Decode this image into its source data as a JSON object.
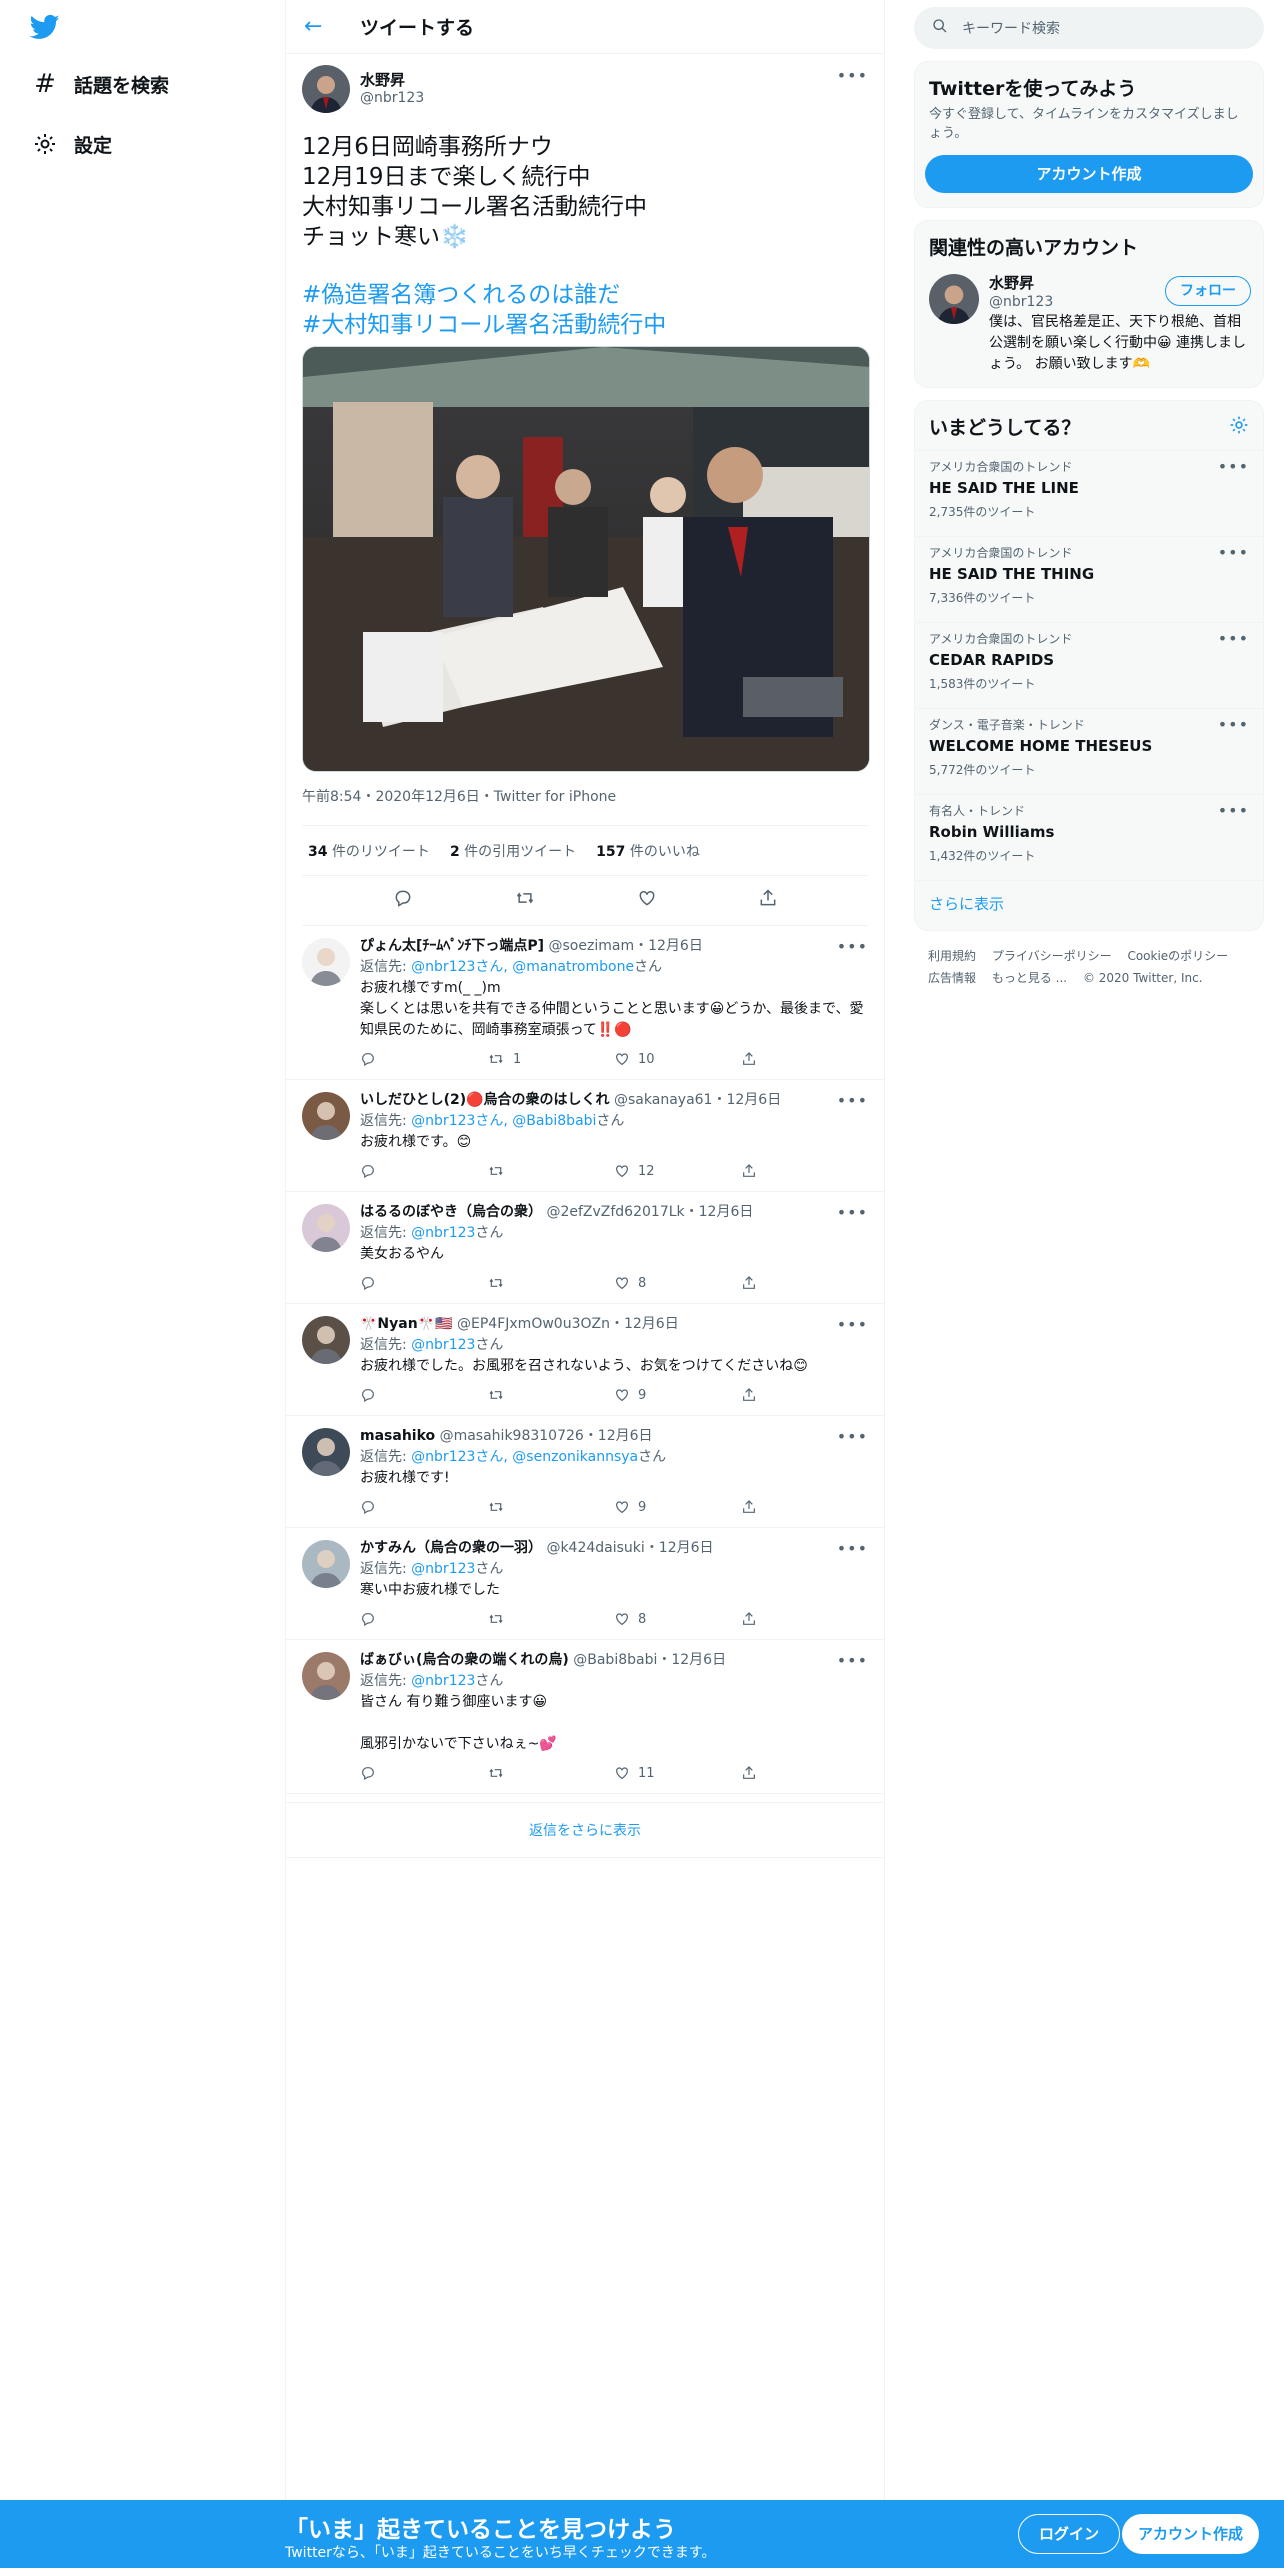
{
  "nav": {
    "explore_label": "話題を検索",
    "settings_label": "設定"
  },
  "header": {
    "title": "ツイートする"
  },
  "tweet": {
    "author_name": "水野昇",
    "author_handle": "@nbr123",
    "body": "12月6日岡崎事務所ナウ\n12月19日まで楽しく続行中\n大村知事リコール署名活動続行中\nチョット寒い❄️",
    "hashtags": [
      "#偽造署名簿つくれるのは誰だ",
      "#大村知事リコール署名活動続行中"
    ],
    "meta": "午前8:54・2020年12月6日・Twitter for iPhone",
    "retweets": "34",
    "retweets_label": "件のリツイート",
    "quotes": "2",
    "quotes_label": "件の引用ツイート",
    "likes": "157",
    "likes_label": "件のいいね"
  },
  "replies": [
    {
      "name": "ぴょん太[ﾁｰﾑﾍﾟﾝﾁ下っ端点P]",
      "handle": "@soezimam",
      "date": "・12月6日",
      "reply_to": "返信先: ",
      "mentions": "@nbr123さん, @manatrombone",
      "suffix": "さん",
      "text": "お疲れ様ですm(_ _)m\n楽しくとは思いを共有できる仲間ということと思います😀どうか、最後まで、愛知県民のために、岡崎事務室頑張って‼️🔴",
      "rt": "1",
      "like": "10"
    },
    {
      "name": "いしだひとし(2)🔴烏合の衆のはしくれ",
      "handle": "@sakanaya61",
      "date": "・12月6日",
      "reply_to": "返信先: ",
      "mentions": "@nbr123さん, @Babi8babi",
      "suffix": "さん",
      "text": "お疲れ様です。😊",
      "rt": "",
      "like": "12"
    },
    {
      "name": "はるるのぼやき（烏合の衆）",
      "handle": "@2efZvZfd62017Lk",
      "date": "・12月6日",
      "reply_to": "返信先: ",
      "mentions": "@nbr123",
      "suffix": "さん",
      "text": "美女おるやん",
      "rt": "",
      "like": "8"
    },
    {
      "name": "🎌Nyan🎌🇺🇸",
      "handle": "@EP4FJxmOw0u3OZn",
      "date": "・12月6日",
      "reply_to": "返信先: ",
      "mentions": "@nbr123",
      "suffix": "さん",
      "text": "お疲れ様でした。お風邪を召されないよう、お気をつけてくださいね😊",
      "rt": "",
      "like": "9"
    },
    {
      "name": "masahiko",
      "handle": "@masahik98310726",
      "date": "・12月6日",
      "reply_to": "返信先: ",
      "mentions": "@nbr123さん, @senzonikannsya",
      "suffix": "さん",
      "text": "お疲れ様です!",
      "rt": "",
      "like": "9"
    },
    {
      "name": "かすみん（烏合の衆の一羽）",
      "handle": "@k424daisuki",
      "date": "・12月6日",
      "reply_to": "返信先: ",
      "mentions": "@nbr123",
      "suffix": "さん",
      "text": "寒い中お疲れ様でした",
      "rt": "",
      "like": "8"
    },
    {
      "name": "ばぁびぃ(烏合の衆の端くれの烏)",
      "handle": "@Babi8babi",
      "date": "・12月6日",
      "reply_to": "返信先: ",
      "mentions": "@nbr123",
      "suffix": "さん",
      "text": "皆さん 有り難う御座います😀\n\n風邪引かないで下さいねぇ~💕",
      "rt": "",
      "like": "11"
    }
  ],
  "show_more_replies": "返信をさらに表示",
  "sidebar": {
    "search_placeholder": "キーワード検索",
    "signup_title": "Twitterを使ってみよう",
    "signup_desc": "今すぐ登録して、タイムラインをカスタマイズしましょう。",
    "signup_button": "アカウント作成",
    "related_title": "関連性の高いアカウント",
    "related_name": "水野昇",
    "related_handle": "@nbr123",
    "related_bio": "僕は、官民格差是正、天下り根絶、首相公選制を願い楽しく行動中😀 連携しましょう。 お願い致します🫶",
    "follow_label": "フォロー",
    "trends_title": "いまどうしてる？",
    "trends": [
      {
        "context": "アメリカ合衆国のトレンド",
        "name": "HE SAID THE LINE",
        "count": "2,735件のツイート"
      },
      {
        "context": "アメリカ合衆国のトレンド",
        "name": "HE SAID THE THING",
        "count": "7,336件のツイート"
      },
      {
        "context": "アメリカ合衆国のトレンド",
        "name": "CEDAR RAPIDS",
        "count": "1,583件のツイート"
      },
      {
        "context": "ダンス・電子音楽・トレンド",
        "name": "WELCOME HOME THESEUS",
        "count": "5,772件のツイート"
      },
      {
        "context": "有名人・トレンド",
        "name": "Robin Williams",
        "count": "1,432件のツイート"
      }
    ],
    "show_more": "さらに表示",
    "footer": [
      "利用規約",
      "プライバシーポリシー",
      "Cookieのポリシー",
      "広告情報",
      "もっと見る ...",
      "© 2020 Twitter, Inc."
    ]
  },
  "banner": {
    "title": "「いま」起きていることを見つけよう",
    "subtitle": "Twitterなら、「いま」起きていることをいち早くチェックできます。",
    "login": "ログイン",
    "signup": "アカウント作成"
  },
  "colors": {
    "accent": "#1d9bf0",
    "text": "#0f1419",
    "muted": "#536471"
  }
}
